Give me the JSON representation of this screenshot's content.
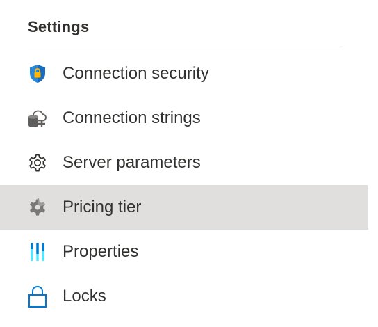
{
  "settings": {
    "title": "Settings",
    "items": [
      {
        "label": "Connection security",
        "icon": "shield-lock-icon",
        "selected": false
      },
      {
        "label": "Connection strings",
        "icon": "database-cloud-plus-icon",
        "selected": false
      },
      {
        "label": "Server parameters",
        "icon": "gear-icon",
        "selected": false
      },
      {
        "label": "Pricing tier",
        "icon": "gear-filled-icon",
        "selected": true
      },
      {
        "label": "Properties",
        "icon": "properties-bars-icon",
        "selected": false
      },
      {
        "label": "Locks",
        "icon": "lock-icon",
        "selected": false
      }
    ]
  },
  "colors": {
    "selected_background": "#e1dfdd",
    "text": "#323130",
    "accent_blue": "#0078d4",
    "shield_yellow": "#ffb900"
  }
}
